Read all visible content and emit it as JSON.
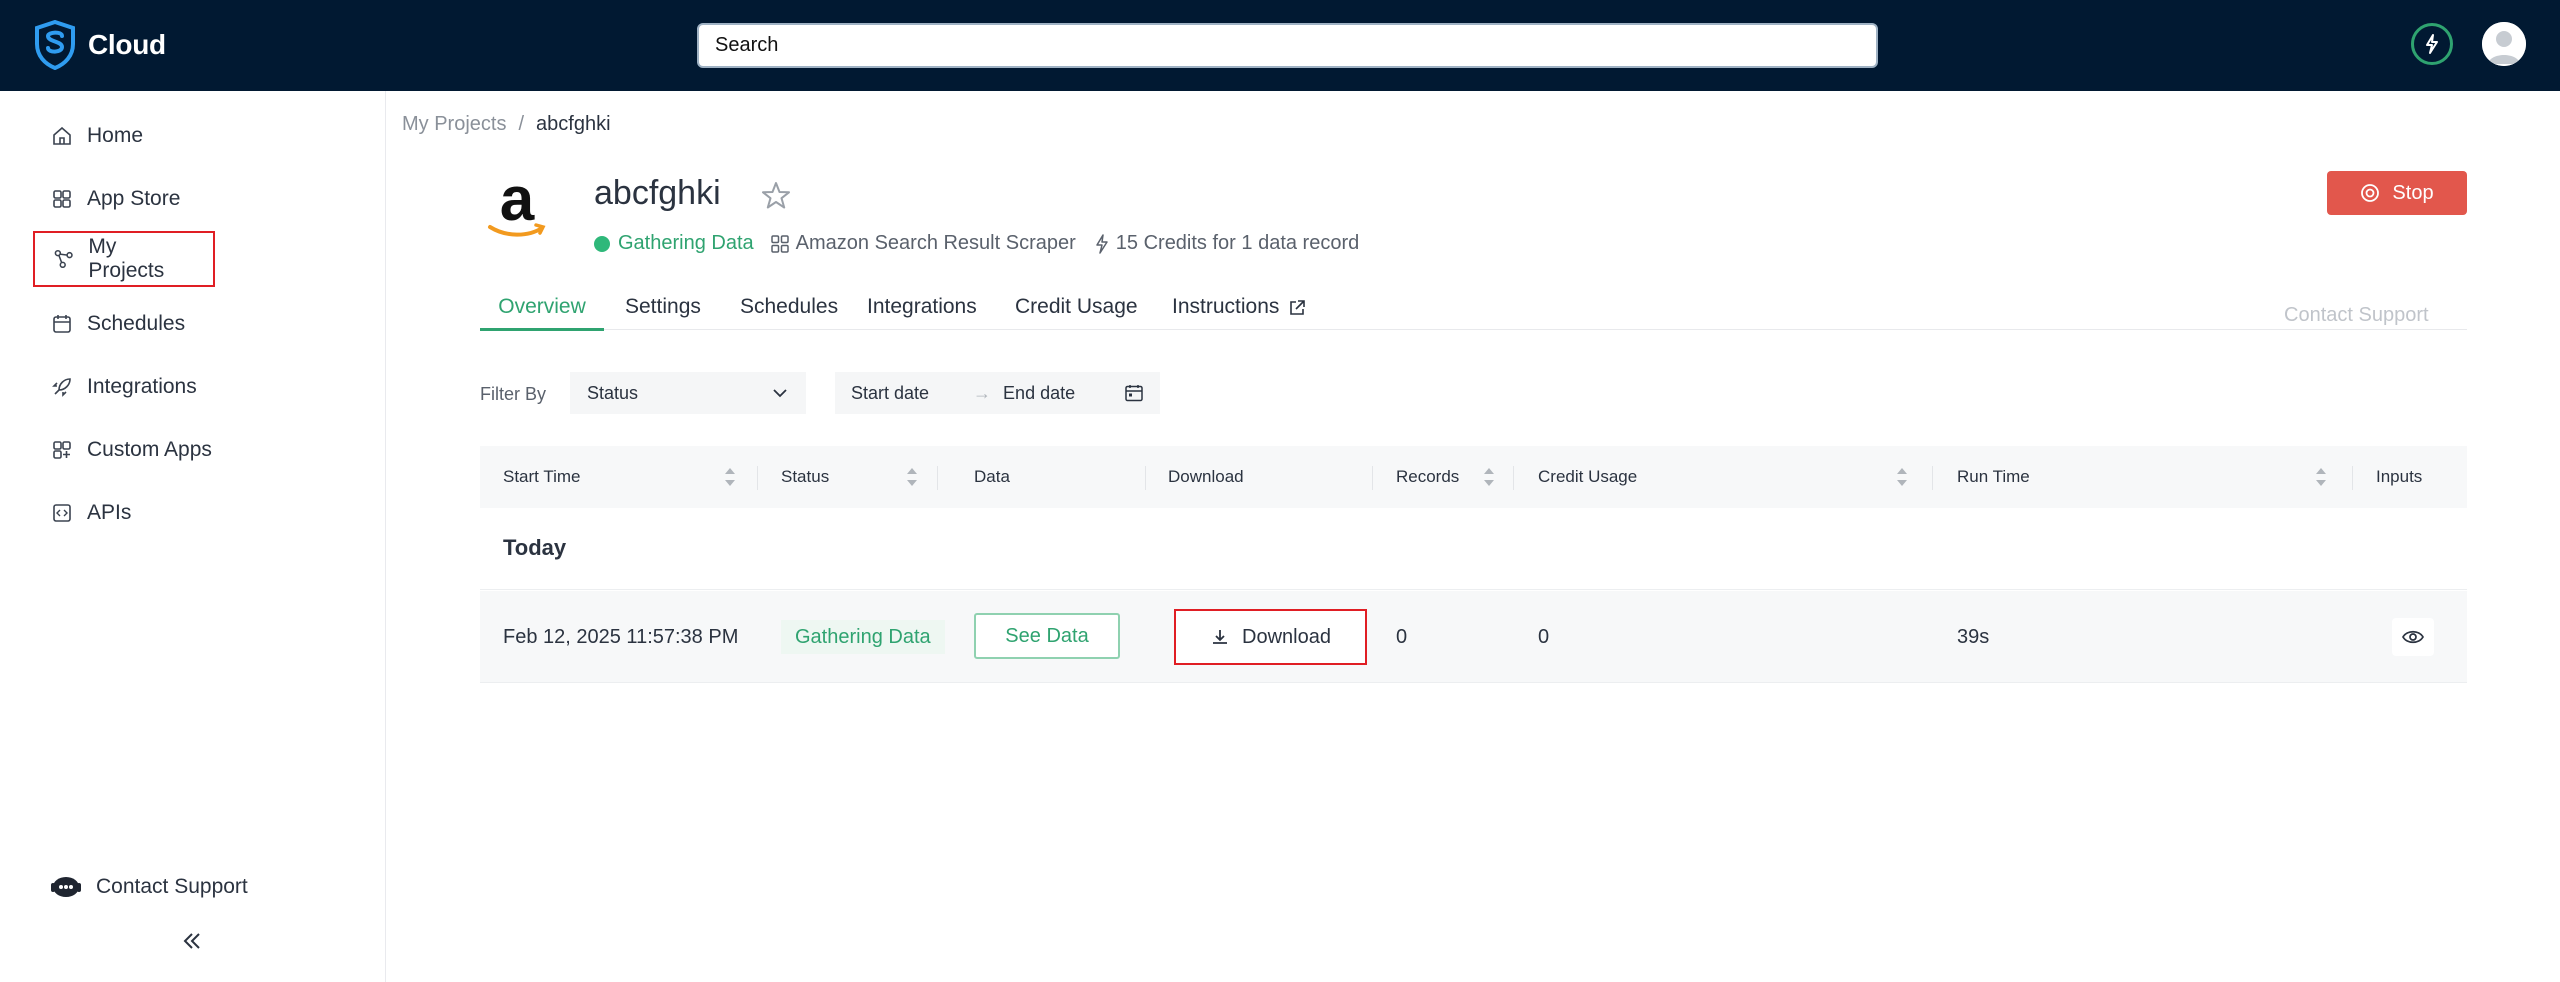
{
  "header": {
    "brand_name": "Cloud",
    "search_placeholder": "Search",
    "bolt_icon": "bolt-icon",
    "avatar_icon": "user-avatar-icon",
    "colors": {
      "bg": "#011932",
      "accent": "#2fa370"
    }
  },
  "sidebar": {
    "items": [
      {
        "label": "Home",
        "icon": "home-icon"
      },
      {
        "label": "App Store",
        "icon": "grid-icon"
      },
      {
        "label": "My Projects",
        "icon": "share-nodes-icon",
        "selected": true
      },
      {
        "label": "Schedules",
        "icon": "calendar-icon"
      },
      {
        "label": "Integrations",
        "icon": "rocket-icon"
      },
      {
        "label": "Custom Apps",
        "icon": "apps-icon"
      },
      {
        "label": "APIs",
        "icon": "code-icon"
      }
    ],
    "contact_support": "Contact Support",
    "collapse_icon": "double-chevron-left-icon"
  },
  "breadcrumb": {
    "parent": "My Projects",
    "separator": "/",
    "current": "abcfghki"
  },
  "project": {
    "title": "abcfghki",
    "status": "Gathering Data",
    "app": "Amazon Search Result Scraper",
    "credits": "15 Credits for 1 data record",
    "stop_label": "Stop",
    "colors": {
      "stop": "#e2574c",
      "status": "#2fb87a"
    }
  },
  "tabs": [
    {
      "label": "Overview",
      "active": true
    },
    {
      "label": "Settings"
    },
    {
      "label": "Schedules"
    },
    {
      "label": "Integrations"
    },
    {
      "label": "Credit Usage"
    },
    {
      "label": "Instructions",
      "icon": "external-link-icon"
    }
  ],
  "contact_support_link": "Contact Support",
  "filters": {
    "label": "Filter By",
    "status_placeholder": "Status",
    "start_date_placeholder": "Start date",
    "end_date_placeholder": "End date",
    "arrow": "→"
  },
  "table": {
    "columns": [
      "Start Time",
      "Status",
      "Data",
      "Download",
      "Records",
      "Credit Usage",
      "Run Time",
      "Inputs"
    ],
    "group_label": "Today",
    "rows": [
      {
        "start_time": "Feb 12, 2025 11:57:38 PM",
        "status": "Gathering Data",
        "data_button": "See Data",
        "download_button": "Download",
        "records": "0",
        "credit_usage": "0",
        "run_time": "39s",
        "inputs_icon": "eye-icon"
      }
    ]
  }
}
